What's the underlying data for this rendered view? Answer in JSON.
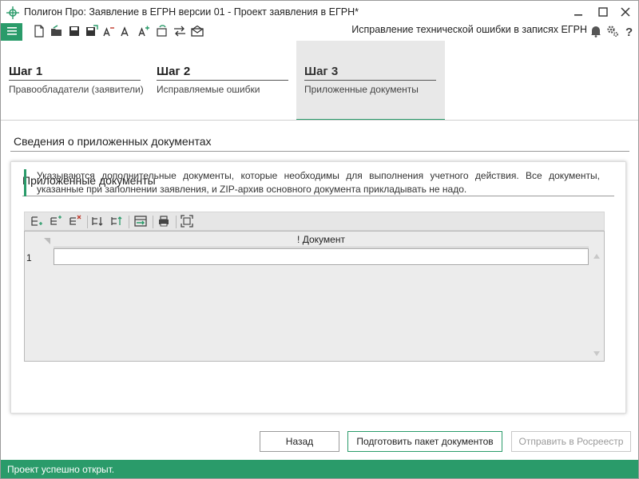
{
  "window": {
    "title": "Полигон Про: Заявление в ЕГРН версии 01 - Проект заявления в ЕГРН*",
    "minimize_icon": "minimize-icon",
    "maximize_icon": "maximize-icon",
    "close_icon": "close-icon"
  },
  "toolbar": {
    "mode_label": "Исправление технической ошибки в записях ЕГРН",
    "icons": [
      "new-file-icon",
      "open-folder-icon",
      "save-icon",
      "save-as-icon",
      "font-decrease-icon",
      "font-normal-icon",
      "font-increase-icon",
      "refresh-icon",
      "swap-icon",
      "mail-icon"
    ],
    "right_icons": [
      "bell-icon",
      "settings-icon",
      "help-icon"
    ]
  },
  "steps": [
    {
      "title": "Шаг 1",
      "subtitle": "Правообладатели (заявители)"
    },
    {
      "title": "Шаг 2",
      "subtitle": "Исправляемые ошибки"
    },
    {
      "title": "Шаг 3",
      "subtitle": "Приложенные документы"
    }
  ],
  "content": {
    "section_title": "Сведения о приложенных документах",
    "panel_title": "Приложенные документы",
    "info_note": "Указываются дополнительные документы, которые необходимы для выполнения учетного действия. Все документы, указанные при заполнении заявления, и ZIP-архив основного документа прикладывать не надо.",
    "grid": {
      "column_header": "! Документ",
      "rows": [
        {
          "num": "1",
          "value": ""
        }
      ]
    }
  },
  "footer": {
    "back_label": "Назад",
    "prepare_label": "Подготовить пакет документов",
    "send_label": "Отправить в Росреестр"
  },
  "status": {
    "message": "Проект успешно открыт."
  },
  "colors": {
    "accent": "#2a9b6a",
    "status_bg": "#2a9b6a"
  }
}
